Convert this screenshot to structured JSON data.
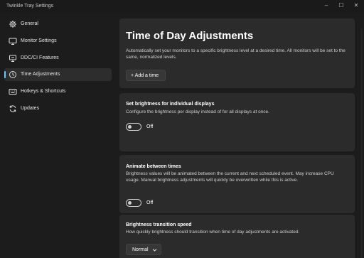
{
  "window": {
    "title": "Twinkle Tray Settings",
    "controls": [
      "–",
      "☐",
      "✕"
    ]
  },
  "sidebar": {
    "items": [
      {
        "label": "General",
        "icon": "gear-icon",
        "active": false
      },
      {
        "label": "Monitor Settings",
        "icon": "monitor-icon",
        "active": false
      },
      {
        "label": "DDC/CI Features",
        "icon": "ddc-icon",
        "active": false
      },
      {
        "label": "Time Adjustments",
        "icon": "clock-icon",
        "active": true
      },
      {
        "label": "Hotkeys & Shortcuts",
        "icon": "keyboard-icon",
        "active": false
      },
      {
        "label": "Updates",
        "icon": "refresh-icon",
        "active": false
      }
    ]
  },
  "main": {
    "header": {
      "title": "Time of Day Adjustments",
      "description": "Automatically set your monitors to a specific brightness level at a desired time. All monitors will be set to the same, normalized levels.",
      "add_button": "+ Add a time"
    },
    "individual": {
      "title": "Set brightness for individual displays",
      "description": "Configure the brightness per display instead of for all displays at once.",
      "toggle_state": "Off"
    },
    "animate": {
      "title": "Animate between times",
      "description": "Brightness values will be animated between the current and next scheduled event. May increase CPU usage. Manual brightness adjustments will quickly be overwritten while this is active.",
      "toggle_state": "Off"
    },
    "transition": {
      "title": "Brightness transition speed",
      "description": "How quickly brightness should transition when time of day adjustments are activated.",
      "selected": "Normal"
    }
  },
  "colors": {
    "accent": "#60cdff",
    "background": "#1c1c1c",
    "card": "#2b2b2b"
  }
}
